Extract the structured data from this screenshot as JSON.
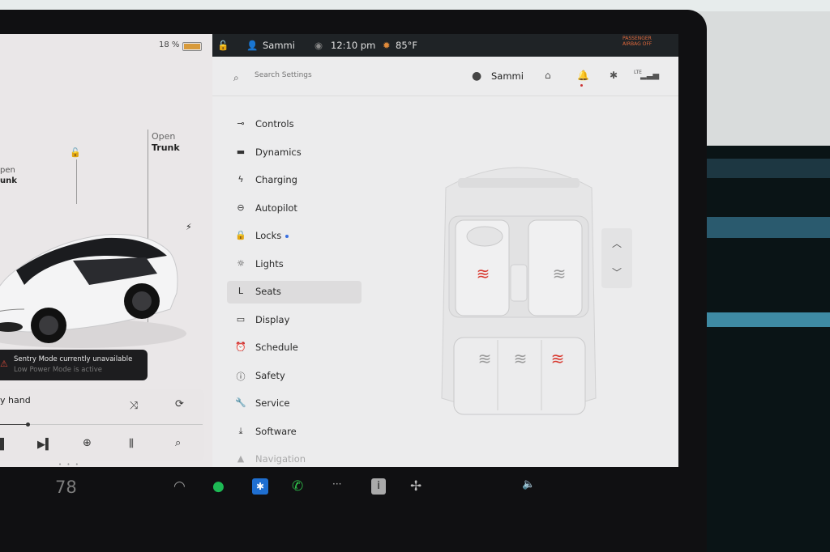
{
  "status": {
    "battery": "18 %",
    "user": "Sammi",
    "time": "12:10 pm",
    "temp": "85°F",
    "airbag": [
      "PASSENGER",
      "AIRBAG OFF"
    ]
  },
  "left": {
    "trunk_open": "Open",
    "trunk_label": "Trunk",
    "frunk_open": "pen",
    "frunk_label": "unk",
    "sentry_title": "Sentry Mode currently unavailable",
    "sentry_sub": "Low Power Mode is active",
    "song": "y hand"
  },
  "header": {
    "search_placeholder": "Search Settings",
    "user": "Sammi",
    "lte": "LTE"
  },
  "menu": [
    {
      "label": "Controls",
      "icon": "toggle-icon"
    },
    {
      "label": "Dynamics",
      "icon": "car-icon"
    },
    {
      "label": "Charging",
      "icon": "bolt-icon"
    },
    {
      "label": "Autopilot",
      "icon": "steering-wheel-icon"
    },
    {
      "label": "Locks",
      "icon": "lock-icon"
    },
    {
      "label": "Lights",
      "icon": "sun-icon"
    },
    {
      "label": "Seats",
      "icon": "seat-icon"
    },
    {
      "label": "Display",
      "icon": "display-icon"
    },
    {
      "label": "Schedule",
      "icon": "alarm-clock-icon"
    },
    {
      "label": "Safety",
      "icon": "alert-circle-icon"
    },
    {
      "label": "Service",
      "icon": "wrench-icon"
    },
    {
      "label": "Software",
      "icon": "download-icon"
    },
    {
      "label": "Navigation",
      "icon": "navigation-icon"
    }
  ],
  "selected_menu": "Seats",
  "seats": {
    "driver_heat": "on",
    "passenger_heat": "off",
    "rear_left_heat": "off",
    "rear_center_heat": "off",
    "rear_right_heat": "on"
  },
  "dock": {
    "temperature": "78"
  },
  "colors": {
    "heat_on": "#d8382e",
    "heat_off": "#9a9a9a",
    "accent_blue": "#3a6fe0",
    "spotify": "#1db954",
    "bluetooth": "#1f6fd1",
    "phone": "#2fbf4a"
  }
}
